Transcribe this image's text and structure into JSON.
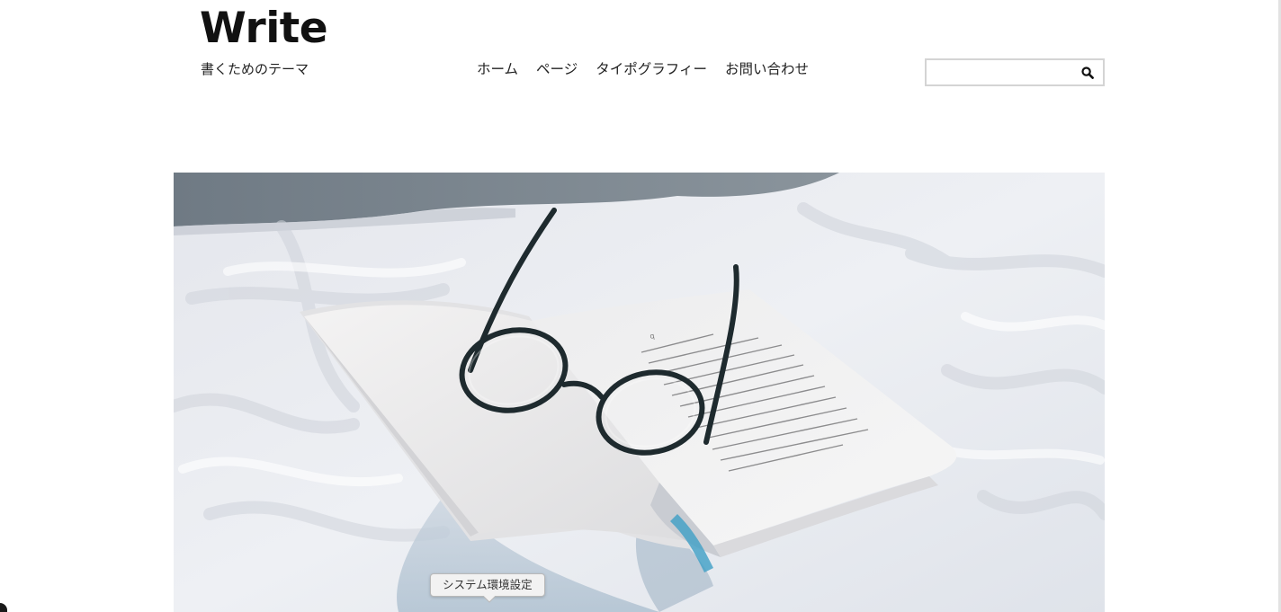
{
  "site": {
    "title": "Write",
    "tagline": "書くためのテーマ"
  },
  "nav": {
    "items": [
      {
        "label": "ホーム"
      },
      {
        "label": "ページ"
      },
      {
        "label": "タイポグラフィー"
      },
      {
        "label": "お問い合わせ"
      }
    ]
  },
  "search": {
    "value": "",
    "placeholder": "",
    "icon": "search-icon"
  },
  "hero": {
    "image": "open-book-with-glasses-on-bed"
  },
  "tooltip": {
    "label": "システム環境設定"
  },
  "colors": {
    "text": "#111111",
    "search_border": "#d4d4d4",
    "tooltip_bg": "#f2f2f2"
  }
}
